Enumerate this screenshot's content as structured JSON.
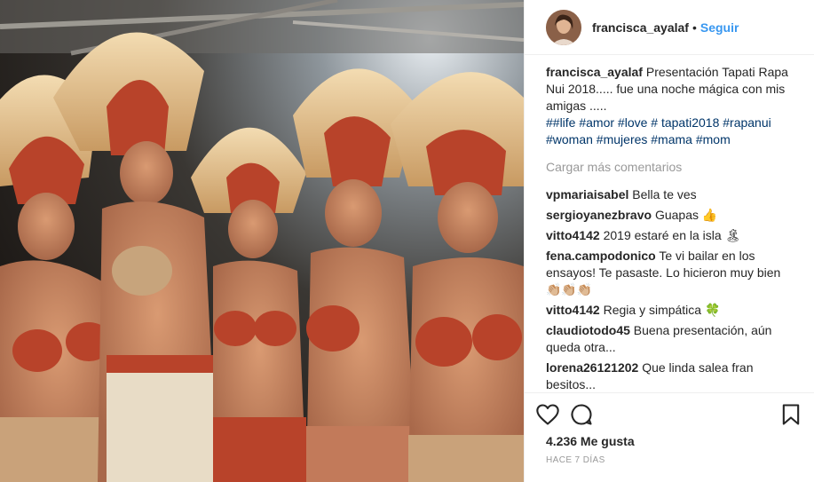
{
  "post": {
    "username": "francisca_ayalaf",
    "follow_separator": "•",
    "follow_label": "Seguir",
    "caption": {
      "username": "francisca_ayalaf",
      "text": "Presentación Tapati Rapa Nui 2018..... fue una noche mágica con mis amigas .....",
      "hashtags": "##life #amor #love # tapati2018 #rapanui #woman #mujeres #mama #mom"
    },
    "load_more_label": "Cargar más comentarios",
    "comments": [
      {
        "user": "vpmariaisabel",
        "text": "Bella te ves"
      },
      {
        "user": "sergioyanezbravo",
        "text": "Guapas 👍"
      },
      {
        "user": "vitto4142",
        "text": "2019 estaré en la isla 🏝"
      },
      {
        "user": "fena.campodonico",
        "text": "Te vi bailar en los ensayos! Te pasaste. Lo hicieron muy bien 👏🏼👏🏼👏🏼"
      },
      {
        "user": "vitto4142",
        "text": "Regia y simpática 🍀"
      },
      {
        "user": "claudiotodo45",
        "text": "Buena presentación, aún queda otra..."
      },
      {
        "user": "lorena26121202",
        "text": "Que linda salea fran besitos..."
      }
    ],
    "likes_label": "4.236 Me gusta",
    "time_label": "HACE 7 DÍAS"
  },
  "colors": {
    "link": "#3897f0",
    "hashtag": "#003569",
    "muted": "#999999",
    "costume_red": "#b8432a",
    "feather": "#e8c79a"
  },
  "icons": {
    "like": "heart-outline-icon",
    "comment": "speech-bubble-icon",
    "save": "bookmark-icon"
  }
}
